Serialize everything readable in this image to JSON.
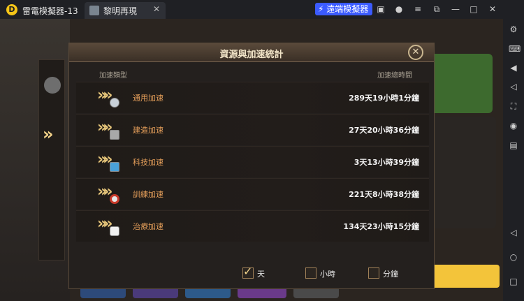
{
  "app": {
    "name": "雷電模擬器-13",
    "tab_title": "黎明再現",
    "remote_button": "遠端模擬器",
    "tab_close": "✕"
  },
  "titlebar_icons": [
    "gift-icon",
    "user-icon",
    "menu-icon",
    "restore-down-icon",
    "minimize-icon",
    "maximize-icon",
    "close-icon"
  ],
  "rightbar_icons": [
    "gear-icon",
    "keyboard-icon",
    "volume-up-icon",
    "volume-down-icon",
    "screenshot-icon",
    "record-icon",
    "more-icon",
    "back-icon",
    "home-icon",
    "recent-icon"
  ],
  "dialog": {
    "title": "資源與加速統計",
    "close_glyph": "✕",
    "col_type": "加速類型",
    "col_time": "加速總時間",
    "rows": [
      {
        "name": "通用加速",
        "value": "289天19小時1分鐘",
        "icon": "general-speedup-icon"
      },
      {
        "name": "建造加速",
        "value": "27天20小時36分鐘",
        "icon": "build-speedup-icon"
      },
      {
        "name": "科技加速",
        "value": "3天13小時39分鐘",
        "icon": "research-speedup-icon"
      },
      {
        "name": "訓練加速",
        "value": "221天8小時38分鐘",
        "icon": "training-speedup-icon"
      },
      {
        "name": "治療加速",
        "value": "134天23小時15分鐘",
        "icon": "healing-speedup-icon"
      }
    ],
    "units": [
      {
        "label": "天",
        "checked": true
      },
      {
        "label": "小時",
        "checked": false
      },
      {
        "label": "分鐘",
        "checked": false
      }
    ]
  },
  "colors": {
    "accent_orange": "#e59f5a",
    "gold": "#e6c57a",
    "remote_blue": "#3b5bff"
  }
}
